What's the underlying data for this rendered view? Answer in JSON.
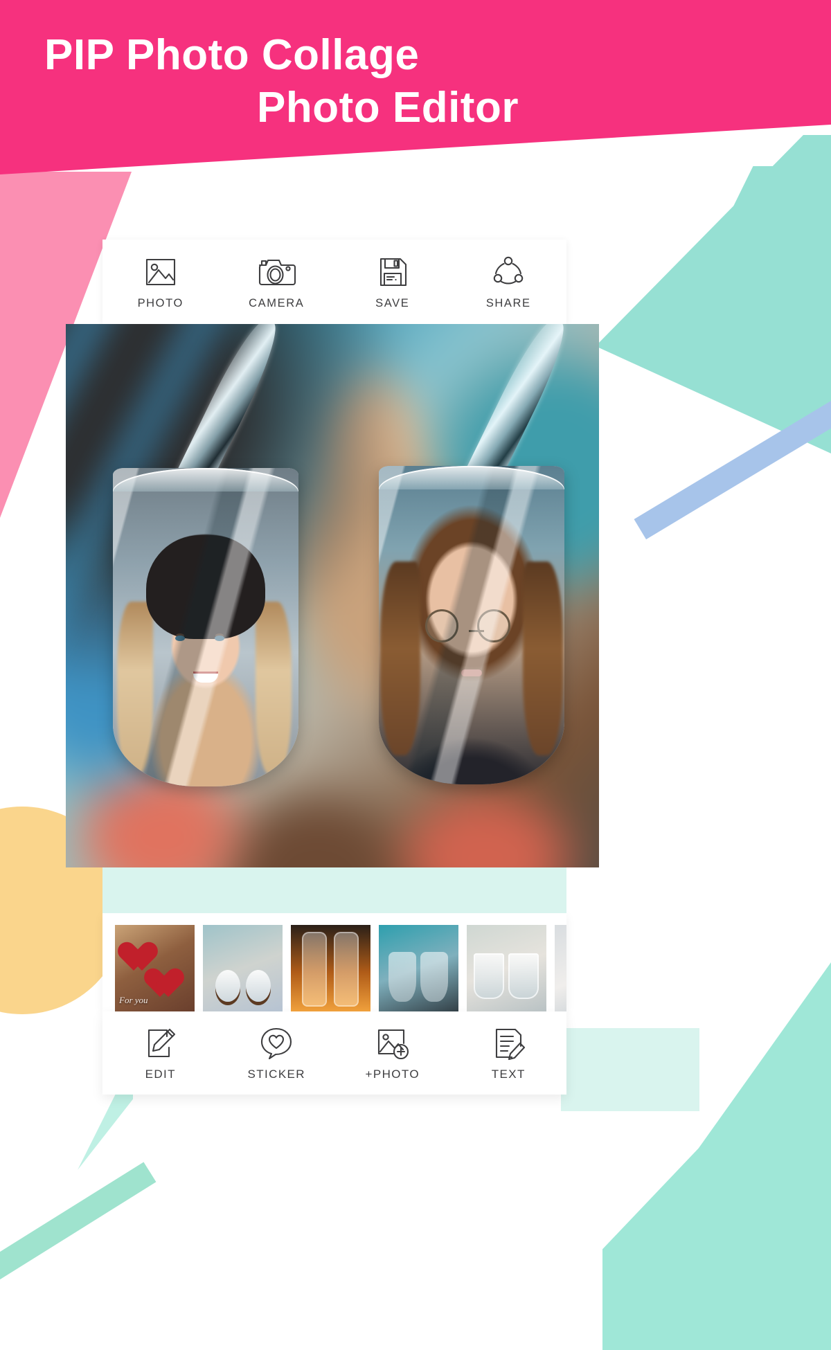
{
  "hero": {
    "title_line1": "PIP Photo Collage",
    "title_line2": "Photo Editor",
    "background_color": "#f6317e",
    "text_color": "#ffffff"
  },
  "colors": {
    "pink": "#f6317e",
    "light_pink": "#fb8fb2",
    "teal": "#96e0d3",
    "mint_band": "#d9f4ee",
    "blue_stripe": "#a7c4ea",
    "orange_circle": "#fad58c",
    "icon_stroke": "#3e3e40"
  },
  "top_toolbar": {
    "items": [
      {
        "label": "PHOTO",
        "icon": "image-icon"
      },
      {
        "label": "CAMERA",
        "icon": "camera-icon"
      },
      {
        "label": "SAVE",
        "icon": "floppy-disk-icon"
      },
      {
        "label": "SHARE",
        "icon": "share-nodes-icon"
      }
    ]
  },
  "canvas": {
    "description": "Two stemless wine glasses with water pouring in, each glass containing a portrait photo",
    "left_glass_photo": "blonde woman in black beanie smiling",
    "right_glass_photo": "brunette woman with round glasses"
  },
  "thumbnails": {
    "items": [
      {
        "name": "heart-frames-for-you",
        "caption": "For you"
      },
      {
        "name": "snow-globes-pair",
        "caption": ""
      },
      {
        "name": "bottles-firelight",
        "caption": ""
      },
      {
        "name": "wine-glasses-pair",
        "caption": ""
      },
      {
        "name": "tumblers-pair",
        "caption": ""
      },
      {
        "name": "more-templates",
        "caption": ""
      }
    ]
  },
  "bottom_toolbar": {
    "items": [
      {
        "label": "EDIT",
        "icon": "pencil-document-icon"
      },
      {
        "label": "STICKER",
        "icon": "heart-speech-bubble-icon"
      },
      {
        "label": "+PHOTO",
        "icon": "add-image-icon"
      },
      {
        "label": "TEXT",
        "icon": "text-document-pencil-icon"
      }
    ]
  }
}
